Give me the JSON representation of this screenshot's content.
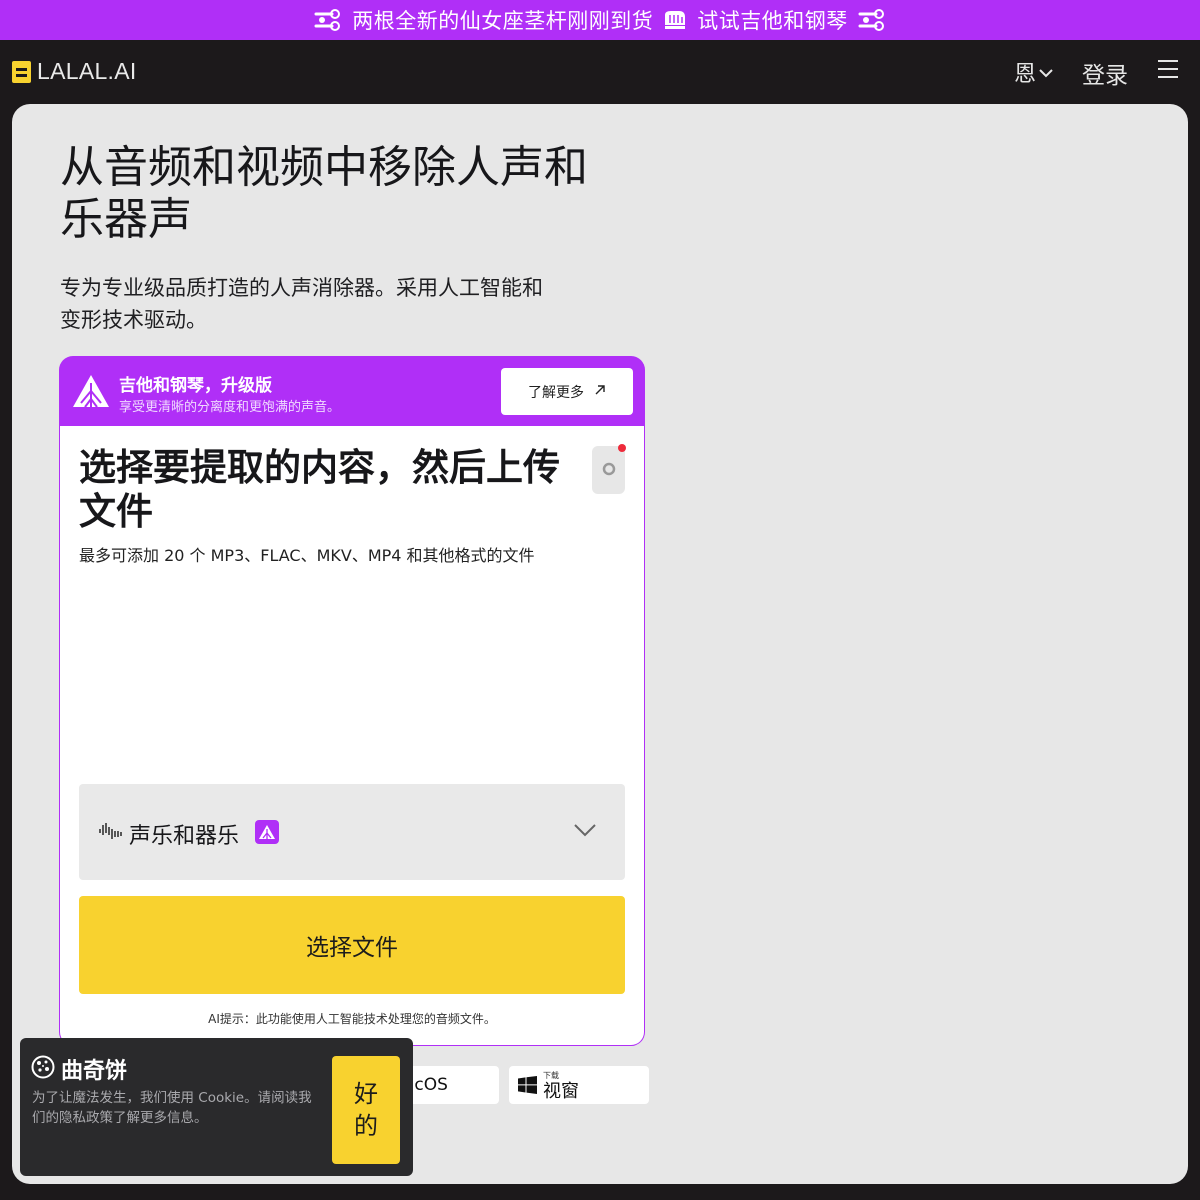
{
  "promo": {
    "text_part1": "两根全新的仙女座茎杆刚刚到货",
    "text_part2": "试试吉他和钢琴",
    "color": "#b02ff7"
  },
  "header": {
    "logo": "LALAL.AI",
    "language": "恩",
    "login": "登录"
  },
  "hero": {
    "title": "从音频和视频中移除人声和乐器声",
    "subtitle": "专为专业级品质打造的人声消除器。采用人工智能和变形技术驱动。"
  },
  "upgrade": {
    "title": "吉他和钢琴，升级版",
    "subtitle": "享受更清晰的分离度和更饱满的声音。",
    "learn_more": "了解更多"
  },
  "uploader": {
    "title": "选择要提取的内容，然后上传文件",
    "subtitle": "最多可添加 20 个 MP3、FLAC、MKV、MP4 和其他格式的文件",
    "stem_selected": "声乐和器乐",
    "choose_button": "选择文件",
    "ai_note": "AI提示：此功能使用人工智能技术处理您的音频文件。"
  },
  "downloads": {
    "mac_label": "acOS",
    "win_small": "下载",
    "win_label": "视窗"
  },
  "cookie": {
    "title": "曲奇饼",
    "text": "为了让魔法发生，我们使用 Cookie。请阅读我们的隐私政策了解更多信息。",
    "ok_button": "好的"
  },
  "colors": {
    "accent_purple": "#b02ff7",
    "accent_yellow": "#f8d22f",
    "background_dark": "#1c191b",
    "panel": "#e7e7e7"
  }
}
